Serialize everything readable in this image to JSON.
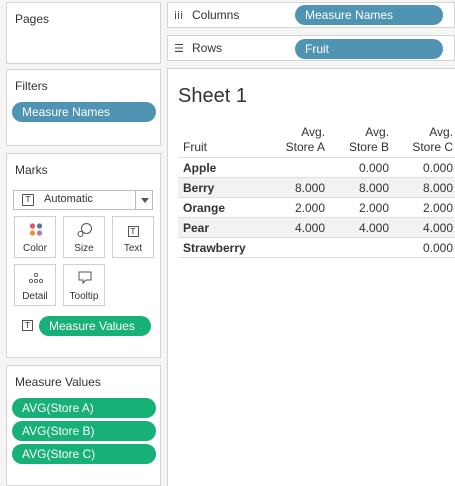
{
  "pages": {
    "title": "Pages"
  },
  "filters": {
    "title": "Filters",
    "pills": [
      {
        "label": "Measure Names"
      }
    ]
  },
  "marks": {
    "title": "Marks",
    "mark_type": "Automatic",
    "buttons": [
      {
        "label": "Color"
      },
      {
        "label": "Size"
      },
      {
        "label": "Text"
      },
      {
        "label": "Detail"
      },
      {
        "label": "Tooltip"
      }
    ],
    "text_field": "Measure Values"
  },
  "measure_values": {
    "title": "Measure Values",
    "pills": [
      {
        "label": "AVG(Store A)"
      },
      {
        "label": "AVG(Store B)"
      },
      {
        "label": "AVG(Store C)"
      }
    ]
  },
  "columns_shelf": {
    "label": "Columns",
    "pill": "Measure Names"
  },
  "rows_shelf": {
    "label": "Rows",
    "pill": "Fruit"
  },
  "sheet": {
    "title": "Sheet 1",
    "row_header": "Fruit",
    "columns": [
      {
        "line1": "Avg.",
        "line2": "Store A"
      },
      {
        "line1": "Avg.",
        "line2": "Store B"
      },
      {
        "line1": "Avg.",
        "line2": "Store C"
      }
    ],
    "rows": [
      {
        "fruit": "Apple",
        "values": [
          "",
          "0.000",
          "0.000"
        ]
      },
      {
        "fruit": "Berry",
        "values": [
          "8.000",
          "8.000",
          "8.000"
        ]
      },
      {
        "fruit": "Orange",
        "values": [
          "2.000",
          "2.000",
          "2.000"
        ]
      },
      {
        "fruit": "Pear",
        "values": [
          "4.000",
          "4.000",
          "4.000"
        ]
      },
      {
        "fruit": "Strawberry",
        "values": [
          "",
          "",
          "0.000"
        ]
      }
    ]
  },
  "colors": {
    "dimension_pill": "#4f94b3",
    "measure_pill": "#17b077"
  }
}
